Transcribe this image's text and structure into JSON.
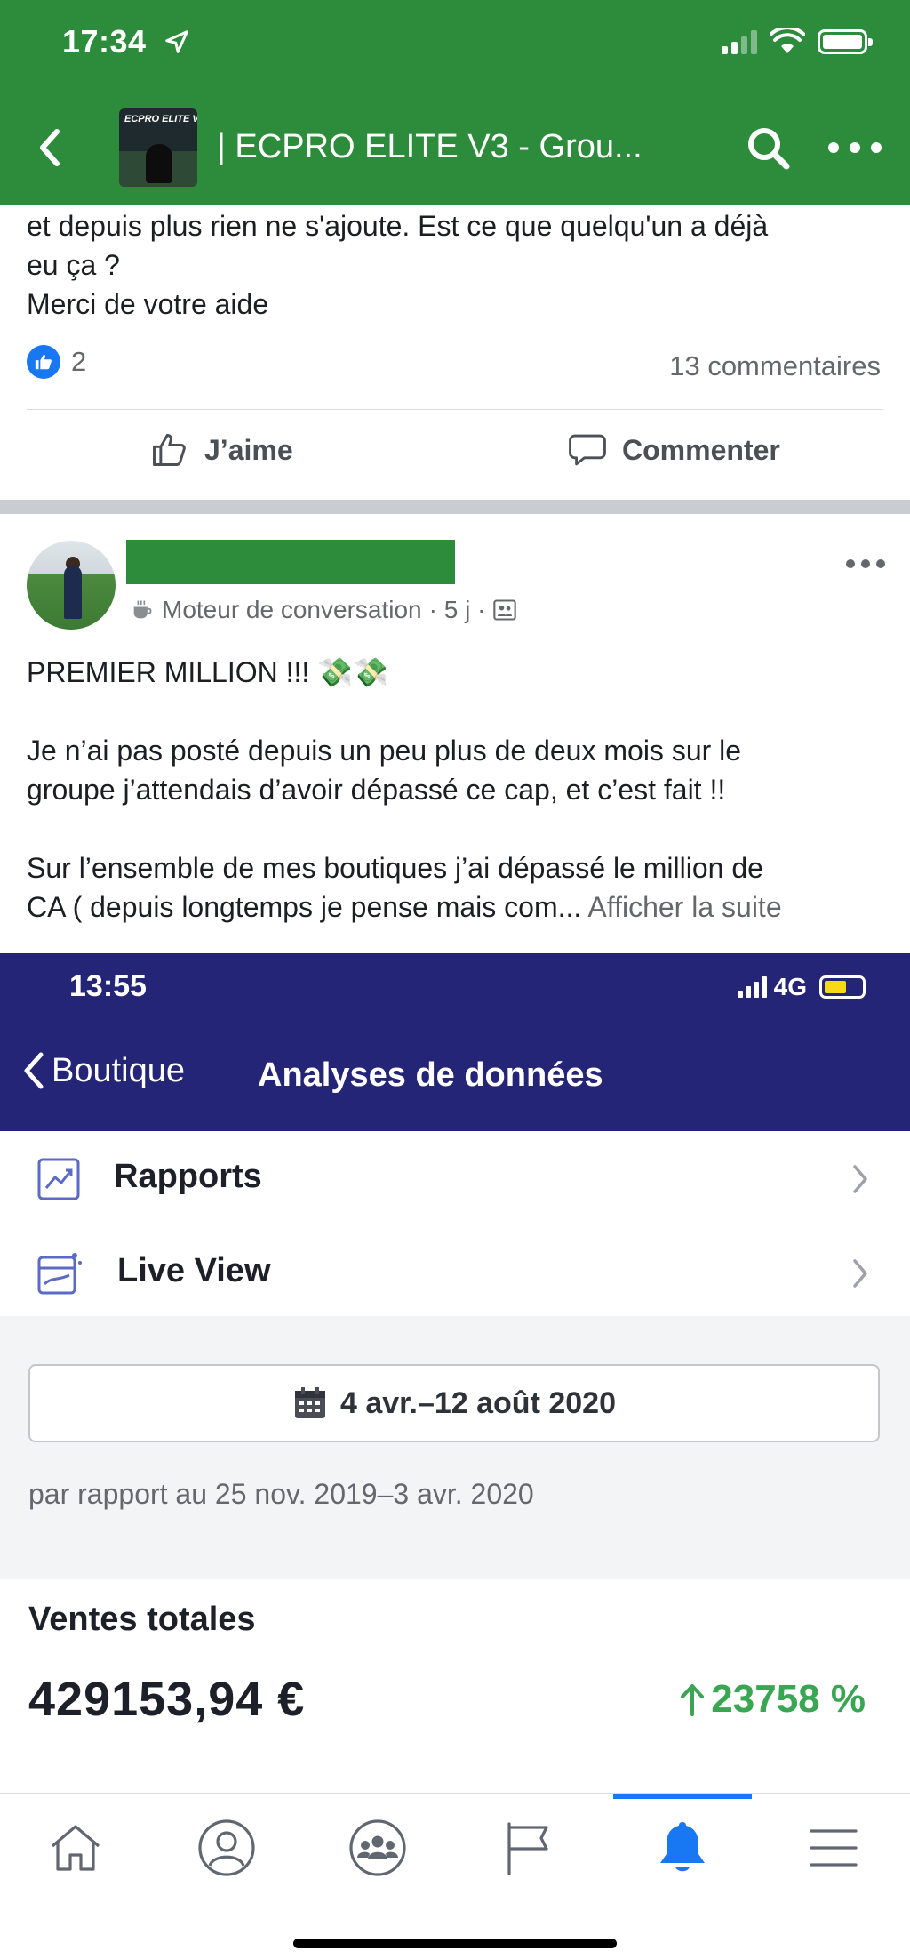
{
  "status": {
    "time": "17:34",
    "icons": [
      "location-arrow-icon",
      "signal-icon",
      "wifi-icon",
      "battery-icon"
    ]
  },
  "header": {
    "group_thumb_text": "ECPRO ELITE V",
    "group_title": "| ECPRO ELITE V3 - Grou...",
    "colors": {
      "bar": "#2d8c3c"
    }
  },
  "post1": {
    "text_lines": [
      "et depuis plus rien ne s'ajoute. Est ce que quelqu'un a déjà",
      "eu ça ?",
      "Merci de votre aide"
    ],
    "like_count": "2",
    "comments": "13 commentaires",
    "like_label": "J’aime",
    "comment_label": "Commenter"
  },
  "post2": {
    "meta_group": "Moteur de conversation",
    "meta_time": "· 5 j ·",
    "headline": "PREMIER MILLION !!! 💸💸",
    "para1_line1": "Je n’ai pas posté depuis un peu plus de deux mois sur le",
    "para1_line2": "groupe j’attendais d’avoir dépassé ce cap, et c’est fait !!",
    "para2_line1": "Sur l’ensemble de mes boutiques j’ai dépassé le million de",
    "para2_line2": "CA ( depuis longtemps je pense mais com...",
    "see_more": "Afficher la suite"
  },
  "embed": {
    "time": "13:55",
    "network": "4G",
    "back_label": "Boutique",
    "title": "Analyses de données",
    "rows": [
      {
        "label": "Rapports",
        "icon": "reports-icon"
      },
      {
        "label": "Live View",
        "icon": "live-view-icon"
      }
    ],
    "date_range": "4 avr.–12 août 2020",
    "compare": "par rapport au 25 nov. 2019–3 avr. 2020",
    "sales_label": "Ventes totales",
    "sales_value": "429153,94 €",
    "sales_change": "23758 %",
    "colors": {
      "header": "#242577",
      "positive": "#3aa653"
    }
  },
  "tabbar": {
    "tabs": [
      "home-icon",
      "profile-icon",
      "groups-icon",
      "pages-icon",
      "notifications-icon",
      "menu-icon"
    ],
    "active": "notifications-icon",
    "colors": {
      "active": "#1877f2"
    }
  }
}
